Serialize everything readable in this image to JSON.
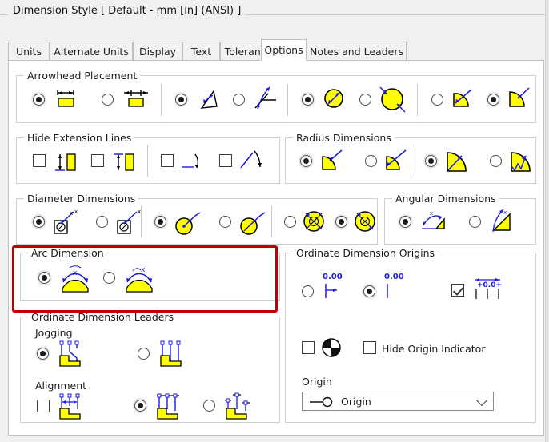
{
  "window": {
    "title": "Dimension Style [ Default - mm [in] (ANSI) ]"
  },
  "tabs": [
    {
      "label": "Units",
      "selected": false
    },
    {
      "label": "Alternate Units",
      "selected": false
    },
    {
      "label": "Display",
      "selected": false
    },
    {
      "label": "Text",
      "selected": false
    },
    {
      "label": "Tolerance",
      "selected": false
    },
    {
      "label": "Options",
      "selected": true
    },
    {
      "label": "Notes and Leaders",
      "selected": false
    }
  ],
  "groups": {
    "arrowhead_placement": {
      "label": "Arrowhead Placement",
      "options": [
        {
          "name": "arrows-inside-linear",
          "type": "radio",
          "checked": true
        },
        {
          "name": "arrows-outside-linear",
          "type": "radio",
          "checked": false
        },
        {
          "name": "arrows-inside-angular",
          "type": "radio",
          "checked": true
        },
        {
          "name": "arrows-outside-angular",
          "type": "radio",
          "checked": false
        },
        {
          "name": "arrows-inside-diameter",
          "type": "radio",
          "checked": true
        },
        {
          "name": "arrows-outside-diameter",
          "type": "radio",
          "checked": false
        },
        {
          "name": "arrows-inside-radius",
          "type": "radio",
          "checked": false
        },
        {
          "name": "arrows-outside-radius",
          "type": "radio",
          "checked": true
        }
      ]
    },
    "hide_extension_lines": {
      "label": "Hide Extension Lines",
      "options": [
        {
          "name": "hide-first-extension-line",
          "type": "checkbox",
          "checked": false
        },
        {
          "name": "hide-second-extension-line",
          "type": "checkbox",
          "checked": false
        },
        {
          "name": "hide-first-angular-extension-line",
          "type": "checkbox",
          "checked": false
        },
        {
          "name": "hide-second-angular-extension-line",
          "type": "checkbox",
          "checked": false
        }
      ]
    },
    "radius_dimensions": {
      "label": "Radius Dimensions",
      "options": [
        {
          "name": "radius-leader-outside",
          "type": "radio",
          "checked": true
        },
        {
          "name": "radius-leader-crossing",
          "type": "radio",
          "checked": false
        },
        {
          "name": "radius-arrow-inside",
          "type": "radio",
          "checked": true
        },
        {
          "name": "radius-arrow-jogged",
          "type": "radio",
          "checked": false
        }
      ]
    },
    "diameter_dimensions": {
      "label": "Diameter Dimensions",
      "options": [
        {
          "name": "diameter-boxed-leader-double",
          "type": "radio",
          "checked": true
        },
        {
          "name": "diameter-boxed-leader-single",
          "type": "radio",
          "checked": false
        },
        {
          "name": "diameter-leader-dot",
          "type": "radio",
          "checked": true
        },
        {
          "name": "diameter-leader-line",
          "type": "radio",
          "checked": false
        },
        {
          "name": "diameter-arrows-outside",
          "type": "radio",
          "checked": false
        },
        {
          "name": "diameter-arrows-inside",
          "type": "radio",
          "checked": true
        }
      ]
    },
    "angular_dimensions": {
      "label": "Angular Dimensions",
      "options": [
        {
          "name": "angular-arc-outside",
          "type": "radio",
          "checked": true
        },
        {
          "name": "angular-arc-crossing",
          "type": "radio",
          "checked": false
        }
      ]
    },
    "arc_dimension": {
      "label": "Arc Dimension",
      "highlighted": true,
      "options": [
        {
          "name": "arc-length-symbol-above",
          "type": "radio",
          "checked": true
        },
        {
          "name": "arc-length-symbol-preceding",
          "type": "radio",
          "checked": false
        }
      ]
    },
    "ordinate_dimension_origins": {
      "label": "Ordinate Dimension Origins",
      "options": [
        {
          "name": "origin-with-arrow",
          "type": "radio",
          "checked": false,
          "value_label": "0.00"
        },
        {
          "name": "origin-plain-line",
          "type": "radio",
          "checked": true,
          "value_label": "0.00"
        },
        {
          "name": "origin-dimension-group",
          "type": "checkbox",
          "checked": true,
          "value_label": "+0.0+"
        },
        {
          "name": "origin-indicator-quadrant",
          "type": "checkbox",
          "checked": false
        }
      ],
      "hide_origin_indicator": {
        "label": "Hide Origin Indicator",
        "checked": false
      },
      "origin_field": {
        "label": "Origin",
        "value": "Origin",
        "options": [
          "Origin"
        ]
      }
    },
    "ordinate_dimension_leaders": {
      "label": "Ordinate Dimension Leaders",
      "jogging": {
        "label": "Jogging",
        "options": [
          {
            "name": "jogging-on",
            "type": "radio",
            "checked": true
          },
          {
            "name": "jogging-off",
            "type": "radio",
            "checked": false
          }
        ]
      },
      "alignment": {
        "label": "Alignment",
        "options": [
          {
            "name": "alignment-spacing",
            "type": "checkbox",
            "checked": false
          },
          {
            "name": "alignment-bottom",
            "type": "radio",
            "checked": true
          },
          {
            "name": "alignment-staggered",
            "type": "radio",
            "checked": false
          }
        ]
      }
    }
  },
  "colors": {
    "accent_yellow": "#ffff00",
    "accent_blue": "#1a1ae0",
    "highlight_red": "#c00000",
    "panel_bg": "#ffffff",
    "window_bg": "#f0f0f0"
  }
}
